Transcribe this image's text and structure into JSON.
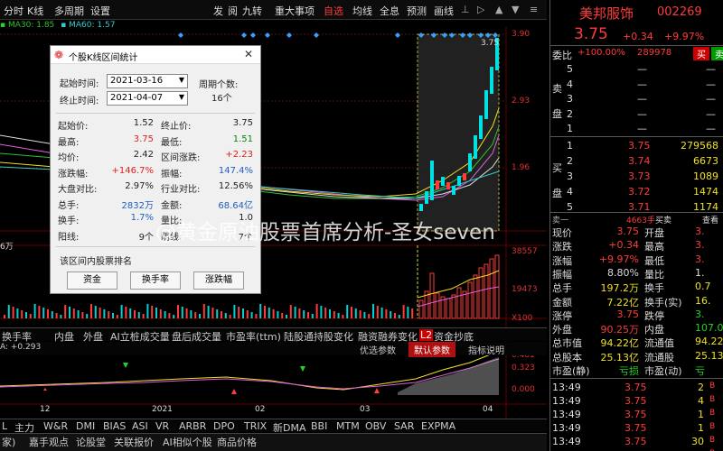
{
  "menu": {
    "items": [
      "分时",
      "K线",
      "多周期",
      "设置"
    ],
    "right_items": [
      "发",
      "阅",
      "九转",
      "重大事项",
      "自选",
      "均线",
      "全息",
      "预测",
      "画线"
    ]
  },
  "ma_line": {
    "ma30": "MA30: 1.85",
    "ma60": "MA60: 1.57"
  },
  "axis": {
    "price_ticks": [
      "3.90",
      "2.93",
      "1.96"
    ],
    "vol_ticks": [
      "38557",
      "19473",
      "X100"
    ],
    "osc_ticks": [
      "0.481",
      "0.323",
      "0.000"
    ],
    "time_ticks": [
      "12",
      "2021",
      "02",
      "03",
      "04"
    ],
    "chart_left_label": "6万"
  },
  "chart_annotations": {
    "peak_label": "3.75"
  },
  "tabs": {
    "row1": [
      "换手率",
      "内盘",
      "外盘",
      "AI立桩成交量",
      "盘后成交量",
      "市盈率(ttm)",
      "陆股通持股变化",
      "融资融券变化",
      "L2",
      "资金抄底"
    ],
    "row2": [
      "主力",
      "W&R",
      "DMI",
      "BIAS",
      "ASI",
      "VR",
      "ARBR",
      "DPO",
      "TRIX",
      "新DMA",
      "BBI",
      "MTM",
      "OBV",
      "SAR",
      "EXPMA"
    ],
    "row3": [
      "家)",
      "嘉手观点",
      "论股堂",
      "关联报价",
      "AI相似个股",
      "商品价格"
    ],
    "param_buttons": [
      "优选参数",
      "默认参数",
      "指标说明"
    ],
    "osc_label": "A: +0.293"
  },
  "dialog": {
    "title": "个股K线区间统计",
    "start_label": "起始时间:",
    "start_value": "2021-03-16",
    "end_label": "终止时间:",
    "end_value": "2021-04-07",
    "period_label": "周期个数:",
    "period_value": "16个",
    "stats": [
      {
        "l": "起始价:",
        "v": "1.52",
        "l2": "终止价:",
        "v2": "3.75"
      },
      {
        "l": "最高:",
        "v": "3.75",
        "l2": "最低:",
        "v2": "1.51"
      },
      {
        "l": "均价:",
        "v": "2.42",
        "l2": "区间涨跌:",
        "v2": "+2.23"
      },
      {
        "l": "涨跌幅:",
        "v": "+146.7%",
        "l2": "振幅:",
        "v2": "147.4%"
      },
      {
        "l": "大盘对比:",
        "v": "2.97%",
        "l2": "行业对比:",
        "v2": "12.56%"
      },
      {
        "l": "总手:",
        "v": "2832万",
        "l2": "金额:",
        "v2": "68.64亿"
      },
      {
        "l": "换手:",
        "v": "1.7%",
        "l2": "量比:",
        "v2": "1.0"
      },
      {
        "l": "阳线:",
        "v": "9个",
        "l2": "阴线:",
        "v2": "7个"
      }
    ],
    "rank_label": "该区间内股票排名",
    "buttons": [
      "资金",
      "换手率",
      "涨跌幅"
    ]
  },
  "watermark": "@黄金原油股票首席分析-圣女seven",
  "quote": {
    "name": "美邦服饰",
    "code": "002269",
    "price": "3.75",
    "change": "+0.34",
    "pct": "+9.97%",
    "weibi_label": "委比",
    "weibi_pct": "+100.00%",
    "weibi_val": "289978",
    "sell_btn": "买",
    "buy_btn": "卖",
    "sell_side_labels": [
      "卖",
      "盘"
    ],
    "buy_side_labels": [
      "买",
      "盘"
    ],
    "asks": [
      {
        "n": "5",
        "p": "—",
        "v": ""
      },
      {
        "n": "4",
        "p": "—",
        "v": ""
      },
      {
        "n": "3",
        "p": "—",
        "v": ""
      },
      {
        "n": "2",
        "p": "—",
        "v": ""
      },
      {
        "n": "1",
        "p": "—",
        "v": ""
      }
    ],
    "bids": [
      {
        "n": "1",
        "p": "3.75",
        "v": "279568"
      },
      {
        "n": "2",
        "p": "3.74",
        "v": "6673"
      },
      {
        "n": "3",
        "p": "3.73",
        "v": "1089"
      },
      {
        "n": "4",
        "p": "3.72",
        "v": "1474"
      },
      {
        "n": "5",
        "p": "3.71",
        "v": "1174"
      }
    ],
    "split_label": "卖一",
    "split_right": "4663手",
    "split_btn": "买卖",
    "split_btn2": "查看",
    "stats_left": [
      {
        "l": "现价",
        "v": "3.75"
      },
      {
        "l": "涨跌",
        "v": "+0.34"
      },
      {
        "l": "涨幅",
        "v": "+9.97%"
      },
      {
        "l": "振幅",
        "v": "8.80%"
      },
      {
        "l": "总手",
        "v": "197.2万"
      },
      {
        "l": "金额",
        "v": "7.22亿"
      },
      {
        "l": "涨停",
        "v": "3.75"
      },
      {
        "l": "外盘",
        "v": "90.25万"
      },
      {
        "l": "总市值",
        "v": "94.22亿"
      },
      {
        "l": "总股本",
        "v": "25.13亿"
      },
      {
        "l": "市盈(静)",
        "v": "亏损"
      }
    ],
    "stats_right": [
      {
        "l": "开盘",
        "v": "3."
      },
      {
        "l": "最高",
        "v": "3."
      },
      {
        "l": "最低",
        "v": "3."
      },
      {
        "l": "量比",
        "v": "1."
      },
      {
        "l": "换手",
        "v": "0.7"
      },
      {
        "l": "换手(实)",
        "v": "16."
      },
      {
        "l": "跌停",
        "v": "3."
      },
      {
        "l": "内盘",
        "v": "107.0"
      },
      {
        "l": "流通值",
        "v": "94.22"
      },
      {
        "l": "流通股",
        "v": "25.13"
      },
      {
        "l": "市盈(动)",
        "v": "亏"
      }
    ],
    "ticks": [
      {
        "t": "13:49",
        "p": "3.75",
        "v": "2"
      },
      {
        "t": "13:49",
        "p": "3.75",
        "v": "4"
      },
      {
        "t": "13:49",
        "p": "3.75",
        "v": "1"
      },
      {
        "t": "13:49",
        "p": "3.75",
        "v": "1"
      },
      {
        "t": "13:49",
        "p": "3.75",
        "v": "30"
      },
      {
        "t": "13:49",
        "p": "3.75",
        "v": ""
      }
    ]
  },
  "colors": {
    "up": "#ff3b3b",
    "down": "#25d325",
    "ma_yellow": "#f0e020",
    "ma_pink": "#e060e0",
    "ma_green": "#30c030",
    "ma_white": "#dddddd"
  }
}
